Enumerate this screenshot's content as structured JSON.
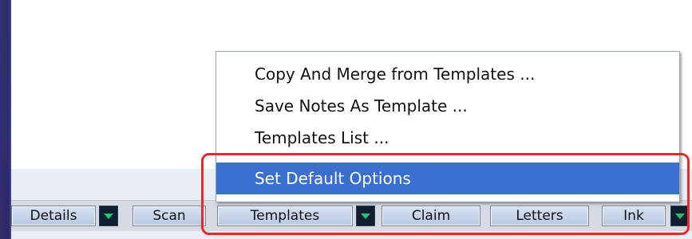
{
  "toolbar": {
    "buttons": [
      {
        "label": "Details"
      },
      {
        "label": "Scan"
      },
      {
        "label": "Templates"
      },
      {
        "label": "Claim"
      },
      {
        "label": "Letters"
      },
      {
        "label": "Ink"
      }
    ]
  },
  "templates_menu": {
    "items": [
      {
        "label": "Copy And Merge from Templates ..."
      },
      {
        "label": "Save Notes As Template ..."
      },
      {
        "label": "Templates List ..."
      },
      {
        "label": "Set Default Options",
        "selected": true
      }
    ]
  },
  "colors": {
    "slide_background": "#262a63",
    "menu_selection": "#3a6fd0",
    "highlight_outline": "#ea2a2a",
    "dropdown_arrow": "#23c46e"
  },
  "icons": [
    "chevron-down-icon"
  ]
}
